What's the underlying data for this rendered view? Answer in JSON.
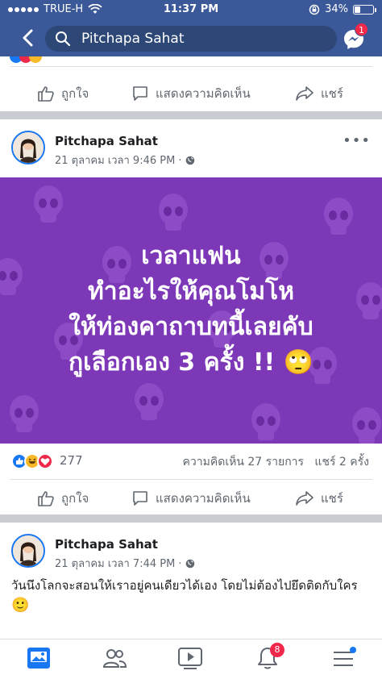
{
  "status_bar": {
    "carrier": "TRUE-H",
    "time": "11:37 PM",
    "battery": "34%",
    "battery_level": 0.34
  },
  "header": {
    "search_text": "Pitchapa Sahat",
    "messenger_badge": "1"
  },
  "top_post": {
    "like_label": "ถูกใจ",
    "comment_label": "แสดงความคิดเห็น",
    "share_label": "แชร์"
  },
  "post1": {
    "author": "Pitchapa Sahat",
    "time": "21 ตุลาคม เวลา 9:46 PM · ",
    "lines": [
      "เวลาแฟน",
      "ทำอะไรให้คุณโมโห",
      "ให้ท่องคาถาบทนี้เลยคับ",
      "กูเลือกเอง 3 ครั้ง !! 🙄"
    ],
    "reaction_count": "277",
    "comments": "ความคิดเห็น 27 รายการ",
    "shares": "แชร์ 2 ครั้ง",
    "like_label": "ถูกใจ",
    "comment_label": "แสดงความคิดเห็น",
    "share_label": "แชร์",
    "background_color": "#7d38b8"
  },
  "post2": {
    "author": "Pitchapa Sahat",
    "time": "21 ตุลาคม เวลา 7:44 PM · ",
    "text": "วันนึงโลกจะสอนให้เราอยู่คนเดียวได้เอง โดยไม่ต้องไปยึดติดกับใคร",
    "emoji": "🙂"
  },
  "bottom_nav": {
    "notifications_badge": "8"
  },
  "colors": {
    "brand": "#3b5998",
    "accent": "#1877f2",
    "badge": "#f02849"
  }
}
